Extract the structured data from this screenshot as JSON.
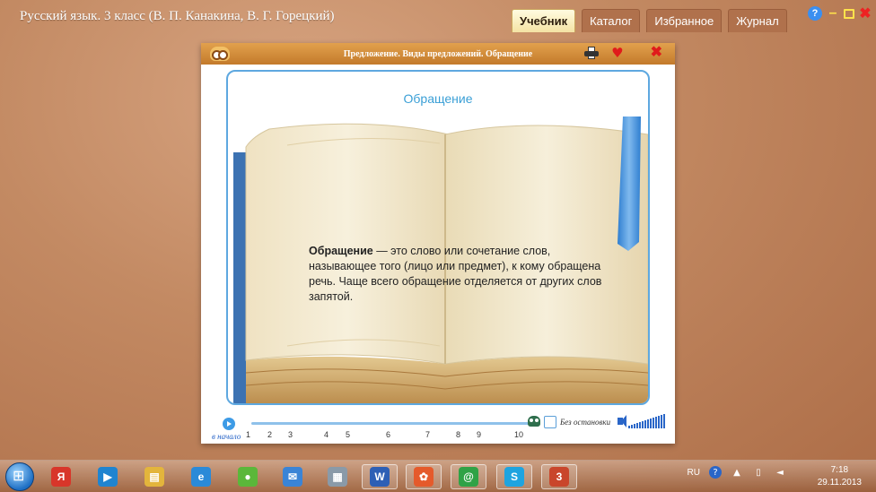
{
  "app": {
    "title": "Русский язык. 3 класс (В. П. Канакина, В. Г. Горецкий)",
    "tabs": [
      {
        "label": "Учебник",
        "active": true
      },
      {
        "label": "Каталог",
        "active": false
      },
      {
        "label": "Избранное",
        "active": false
      },
      {
        "label": "Журнал",
        "active": false
      }
    ],
    "controls": {
      "help": "?",
      "min": "–",
      "close": "✖"
    }
  },
  "lesson": {
    "title": "Предложение. Виды предложений. Обращение",
    "slide_heading": "Обращение",
    "term": "Обращение",
    "definition": " — это слово или сочетание слов, называющее того (лицо или предмет), к кому обращена речь. Чаще всего обращение отделяется от других слов запятой.",
    "close_glyph": "✖",
    "heart_glyph": "♥"
  },
  "footer": {
    "to_start": "в начало",
    "ticks": [
      "1",
      "2",
      "3",
      "4",
      "5",
      "6",
      "7",
      "8",
      "9",
      "10"
    ],
    "no_stop": "Без остановки"
  },
  "taskbar": {
    "items": [
      {
        "name": "yandex-browser-icon",
        "glyph": "Я",
        "color": "#d8362a",
        "pinned": false
      },
      {
        "name": "media-player-icon",
        "glyph": "▶",
        "color": "#1f84d0",
        "pinned": false
      },
      {
        "name": "file-explorer-icon",
        "glyph": "▤",
        "color": "#e3b53c",
        "pinned": false
      },
      {
        "name": "internet-explorer-icon",
        "glyph": "e",
        "color": "#2b8ad8",
        "pinned": false
      },
      {
        "name": "media-app-icon",
        "glyph": "●",
        "color": "#5bb73a",
        "pinned": false
      },
      {
        "name": "mail-icon",
        "glyph": "✉",
        "color": "#3a84d6",
        "pinned": false
      },
      {
        "name": "calculator-icon",
        "glyph": "▦",
        "color": "#8a9aa8",
        "pinned": false
      },
      {
        "name": "word-icon",
        "glyph": "W",
        "color": "#2d5fb5",
        "pinned": true
      },
      {
        "name": "colorful-app-icon",
        "glyph": "✿",
        "color": "#e55a2b",
        "pinned": true
      },
      {
        "name": "mail-ru-agent-icon",
        "glyph": "@",
        "color": "#2fa246",
        "pinned": true
      },
      {
        "name": "skype-icon",
        "glyph": "S",
        "color": "#1ea4e0",
        "pinned": true
      },
      {
        "name": "textbook-app-icon",
        "glyph": "3",
        "color": "#c9462b",
        "pinned": true
      }
    ],
    "lang": "RU",
    "time": "7:18",
    "date": "29.11.2013"
  }
}
